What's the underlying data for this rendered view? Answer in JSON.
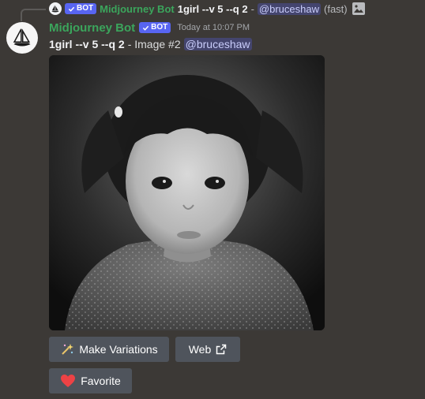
{
  "reply": {
    "bot_badge": "BOT",
    "author": "Midjourney Bot",
    "prompt": "1girl --v 5 --q 2",
    "separator": "-",
    "mention": "@bruceshaw",
    "speed": "(fast)"
  },
  "message": {
    "author": "Midjourney Bot",
    "bot_badge": "BOT",
    "timestamp": "Today at 10:07 PM",
    "prompt": "1girl --v 5 --q 2",
    "image_label": "- Image #2",
    "mention": "@bruceshaw"
  },
  "buttons": {
    "make_variations": "Make Variations",
    "web": "Web",
    "favorite": "Favorite"
  },
  "colors": {
    "background": "#3c3936",
    "bot_name": "#3ba55c",
    "bot_badge": "#5865f2",
    "button": "#4f545c",
    "heart": "#ed4245"
  },
  "icons": [
    "midjourney-sailboat-icon",
    "checkmark-icon",
    "image-icon",
    "sparkles-icon",
    "external-link-icon",
    "heart-icon"
  ]
}
